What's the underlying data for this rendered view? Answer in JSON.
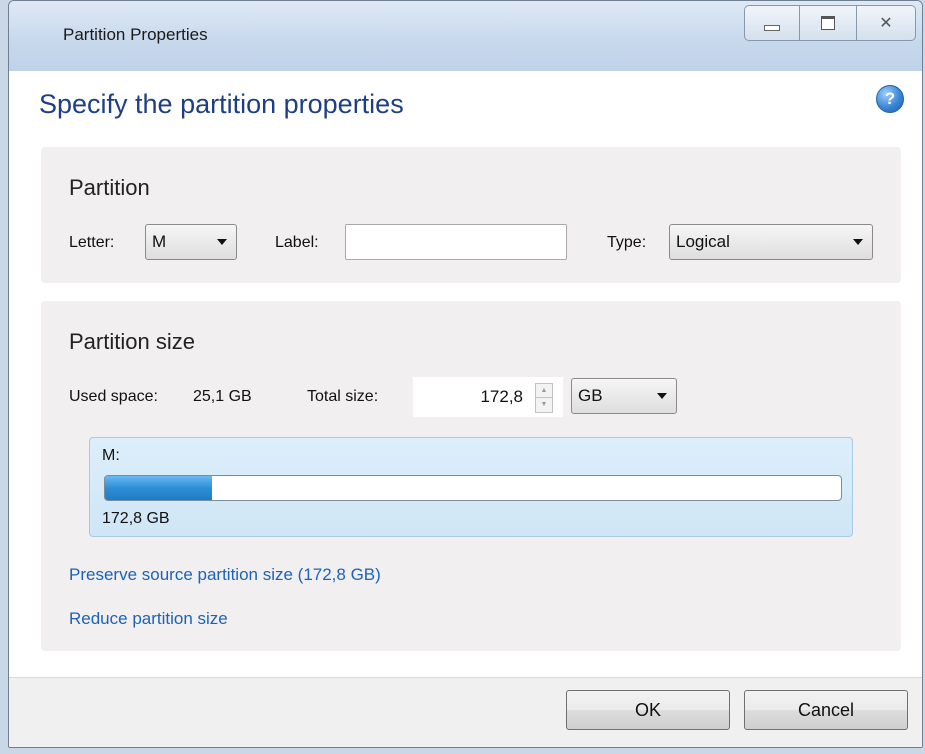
{
  "window": {
    "title": "Partition Properties"
  },
  "heading": "Specify the partition properties",
  "partition": {
    "title": "Partition",
    "letter_label": "Letter:",
    "letter_value": "M",
    "label_label": "Label:",
    "label_value": "",
    "type_label": "Type:",
    "type_value": "Logical"
  },
  "size": {
    "title": "Partition size",
    "used_label": "Used space:",
    "used_value": "25,1 GB",
    "total_label": "Total size:",
    "total_value": "172,8",
    "unit_value": "GB",
    "disk_letter": "M:",
    "disk_total": "172,8 GB",
    "used_fraction": 0.145
  },
  "links": {
    "preserve": "Preserve source partition size (172,8 GB)",
    "reduce": "Reduce partition size"
  },
  "buttons": {
    "ok": "OK",
    "cancel": "Cancel"
  },
  "colors": {
    "heading": "#1e3f86",
    "link": "#1c63b8",
    "bar_fill": "#2c8fd6"
  }
}
